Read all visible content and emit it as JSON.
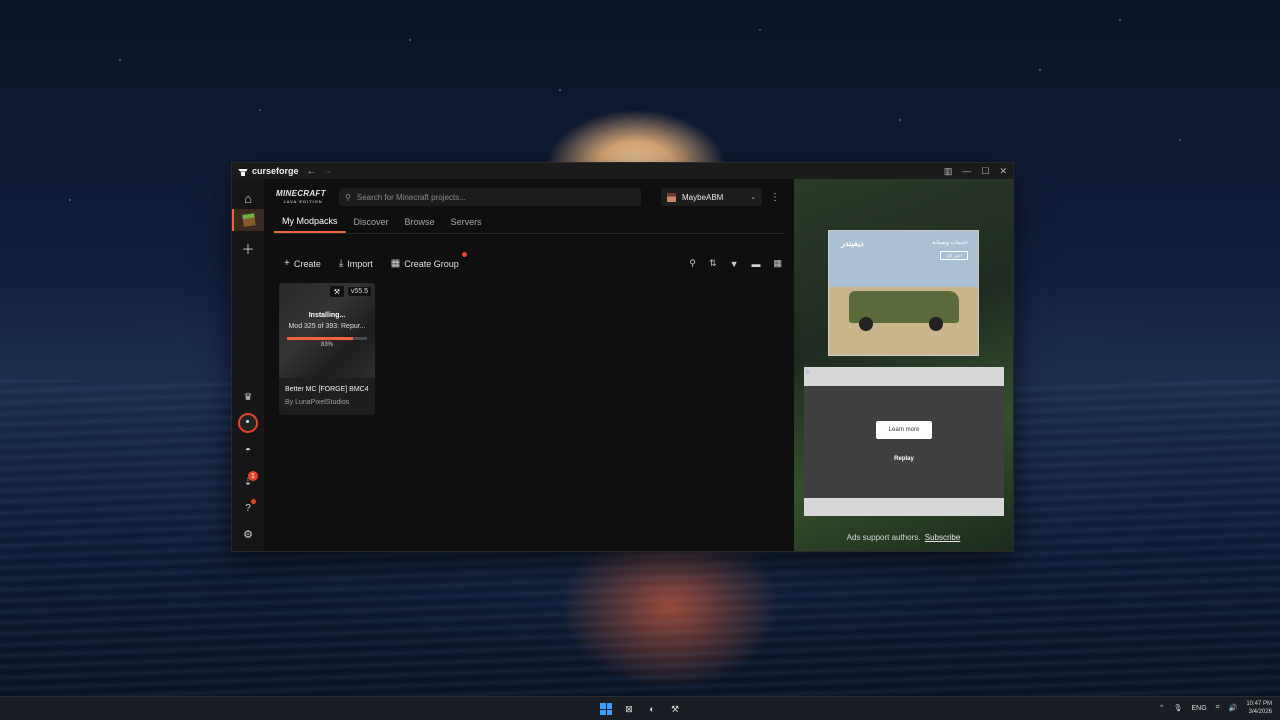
{
  "app": {
    "title": "curseforge",
    "nav_back": "←",
    "nav_forward": "→"
  },
  "window_controls": [
    "▥",
    "—",
    "☐",
    "✕"
  ],
  "rail": {
    "icons": [
      "home-icon",
      "minecraft-icon",
      "plus-icon",
      "crown-icon",
      "record-icon",
      "discord-icon",
      "downloads-icon",
      "help-icon",
      "settings-icon"
    ],
    "downloads_badge": "1"
  },
  "header": {
    "game_logo": "MINECRAFT",
    "game_edition": "JAVA EDITION",
    "search_placeholder": "Search for Minecraft projects...",
    "profile_name": "MaybeABM"
  },
  "tabs": [
    {
      "label": "My Modpacks",
      "active": true
    },
    {
      "label": "Discover",
      "active": false
    },
    {
      "label": "Browse",
      "active": false
    },
    {
      "label": "Servers",
      "active": false
    }
  ],
  "toolbar": {
    "create": "Create",
    "import": "Import",
    "create_group": "Create Group"
  },
  "modpack": {
    "version": "v55.5",
    "status": "Installing...",
    "mod_progress": "Mod 325 of 393: Repur...",
    "progress_label": "83%",
    "progress": 0.83,
    "name": "Better MC [FORGE] BMC4",
    "author": "By LunaPixelStudios"
  },
  "ads": {
    "ad1_title_ar": "ديفيندر",
    "ad1_sub_ar": "خدمات وصيانة",
    "ad1_cta_ar": "احجز الآن",
    "learn_more": "Learn more",
    "replay": "Replay",
    "support_text": "Ads support authors.",
    "subscribe": "Subscribe"
  },
  "taskbar": {
    "lang": "ENG",
    "time": "10:47 PM",
    "date": "3/4/2026"
  },
  "colors": {
    "accent": "#f16436",
    "window_bg": "#121212",
    "badge": "#e0452a"
  }
}
